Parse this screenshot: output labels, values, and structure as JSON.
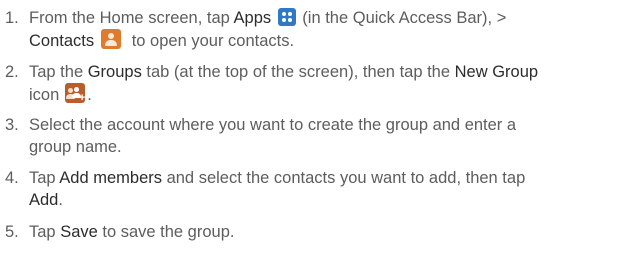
{
  "steps": [
    {
      "number": "1.",
      "line1": {
        "t1": "From the Home screen, tap ",
        "apps": "Apps",
        "t2": " (in the Quick Access Bar), >"
      },
      "line2": {
        "contacts": "Contacts",
        "t3": " to open your contacts."
      },
      "icons": [
        "apps-grid-icon",
        "contacts-person-icon"
      ]
    },
    {
      "number": "2.",
      "line1": {
        "t1": "Tap the ",
        "groups": "Groups",
        "t2": " tab (at the top of the screen), then tap the ",
        "newgroup": "New Group"
      },
      "line2": {
        "icon_word": "icon",
        "t3": "."
      },
      "icons": [
        "new-group-icon"
      ]
    },
    {
      "number": "3.",
      "line1": "Select the account where you want to create the group and enter a",
      "line2": "group name."
    },
    {
      "number": "4.",
      "line1": {
        "t1": "Tap ",
        "add_members": "Add members",
        "t2": " and select the contacts you want to add, then tap"
      },
      "line2": {
        "add": "Add",
        "t3": "."
      }
    },
    {
      "number": "5.",
      "line1": {
        "t1": "Tap ",
        "save": "Save",
        "t2": " to save the group."
      }
    }
  ],
  "colors": {
    "text": "#5d5d5d",
    "emphasis": "#2c2c2c",
    "apps_icon": "#2f79c8",
    "contacts_icon": "#e07a2c",
    "group_icon": "#b85d2b"
  }
}
